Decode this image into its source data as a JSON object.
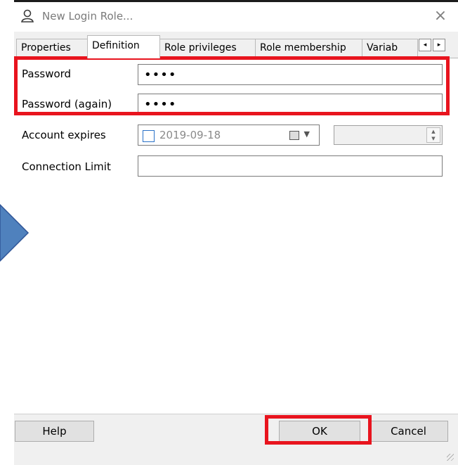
{
  "window": {
    "title": "New Login Role...",
    "close_glyph": "×",
    "icon": "user-icon"
  },
  "tabs": [
    {
      "label": "Properties",
      "active": false
    },
    {
      "label": "Definition",
      "active": true
    },
    {
      "label": "Role privileges",
      "active": false
    },
    {
      "label": "Role membership",
      "active": false
    },
    {
      "label": "Variab",
      "active": false
    }
  ],
  "tab_scroll": {
    "left": "◂",
    "right": "▸"
  },
  "form": {
    "password_label": "Password",
    "password_value": "••••",
    "password_again_label": "Password (again)",
    "password_again_value": "••••",
    "account_expires_label": "Account expires",
    "account_expires_date": "2019-09-18",
    "account_expires_checked": false,
    "connection_limit_label": "Connection Limit",
    "connection_limit_value": ""
  },
  "buttons": {
    "help": "Help",
    "ok": "OK",
    "cancel": "Cancel"
  },
  "colors": {
    "highlight": "#e8141e",
    "arrow_fill": "#4f81bd",
    "checkbox_border": "#2a72c8"
  }
}
